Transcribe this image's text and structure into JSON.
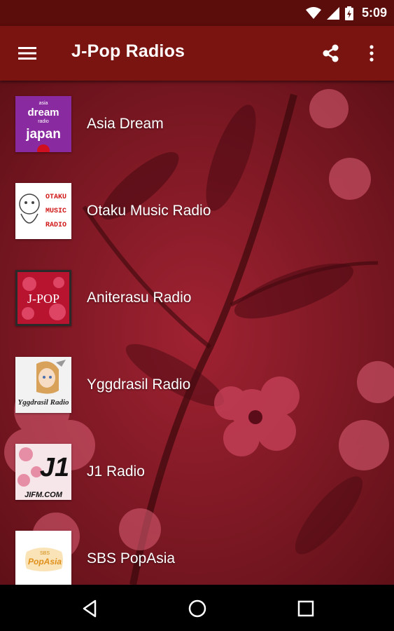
{
  "status_bar": {
    "time": "5:09"
  },
  "app_bar": {
    "title": "J-Pop Radios",
    "menu_icon": "hamburger-menu-icon",
    "share_icon": "share-icon",
    "more_icon": "more-vert-icon"
  },
  "stations": [
    {
      "name": "Asia Dream",
      "logo": {
        "line1": "asia",
        "line2": "dream",
        "line3": "radio",
        "line4": "japan"
      }
    },
    {
      "name": "Otaku Music Radio",
      "logo": {
        "lines": [
          "OTAKU",
          "MUSIC",
          "RADIO"
        ]
      }
    },
    {
      "name": "Aniterasu Radio",
      "logo": {
        "text": "J-POP"
      }
    },
    {
      "name": "Yggdrasil Radio",
      "logo": {
        "text": "Yggdrasil Radio"
      }
    },
    {
      "name": "J1 Radio",
      "logo": {
        "big": "J1",
        "small": "JIFM.COM"
      }
    },
    {
      "name": "SBS PopAsia",
      "logo": {
        "small": "SBS",
        "text": "PopAsia"
      }
    }
  ],
  "nav_bar": {
    "back_icon": "back-triangle-icon",
    "home_icon": "home-circle-icon",
    "recents_icon": "recents-square-icon"
  },
  "colors": {
    "status_bar": "#5a0d0a",
    "app_bar": "#7a1410",
    "background": "#8a1b25"
  }
}
